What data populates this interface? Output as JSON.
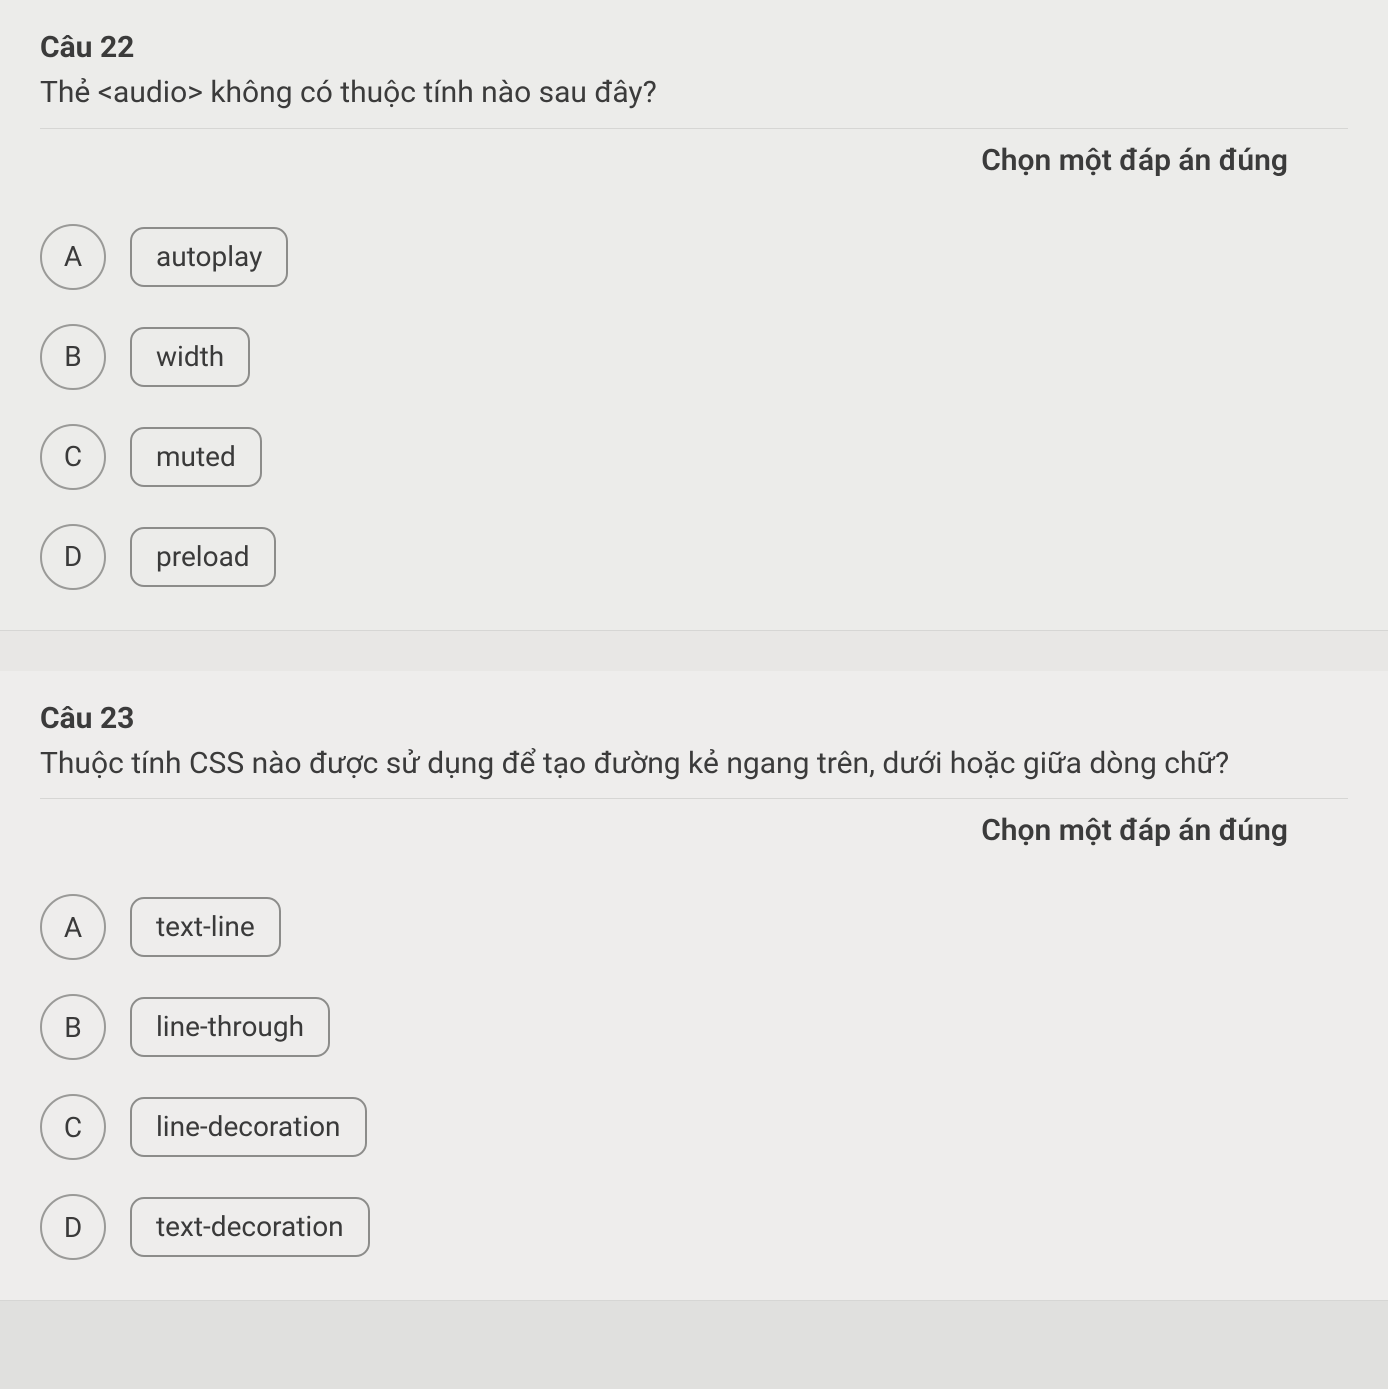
{
  "questions": [
    {
      "title": "Câu 22",
      "text": "Thẻ <audio> không có thuộc tính nào sau đây?",
      "instruction": "Chọn một đáp án đúng",
      "options": [
        {
          "letter": "A",
          "label": "autoplay"
        },
        {
          "letter": "B",
          "label": "width"
        },
        {
          "letter": "C",
          "label": "muted"
        },
        {
          "letter": "D",
          "label": "preload"
        }
      ]
    },
    {
      "title": "Câu 23",
      "text": "Thuộc tính CSS nào được sử dụng để tạo đường kẻ ngang trên, dưới hoặc giữa dòng chữ?",
      "instruction": "Chọn một đáp án đúng",
      "options": [
        {
          "letter": "A",
          "label": "text-line"
        },
        {
          "letter": "B",
          "label": "line-through"
        },
        {
          "letter": "C",
          "label": "line-decoration"
        },
        {
          "letter": "D",
          "label": "text-decoration"
        }
      ]
    }
  ]
}
